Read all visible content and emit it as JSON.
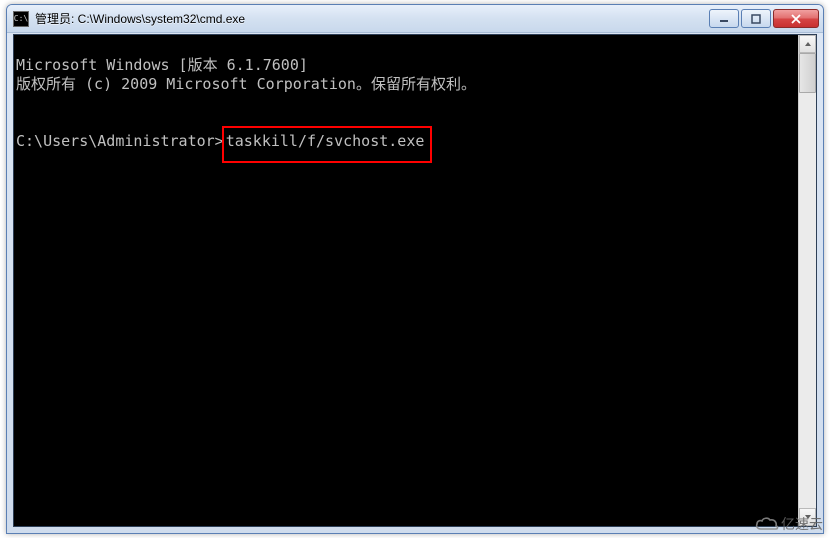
{
  "window": {
    "icon_glyph": "C:\\",
    "title": "管理员: C:\\Windows\\system32\\cmd.exe"
  },
  "console": {
    "line1": "Microsoft Windows [版本 6.1.7600]",
    "line2": "版权所有 (c) 2009 Microsoft Corporation。保留所有权利。",
    "prompt": "C:\\Users\\Administrator>",
    "command": "taskkill/f/svchost.exe"
  },
  "watermark": {
    "text": "亿速云"
  }
}
